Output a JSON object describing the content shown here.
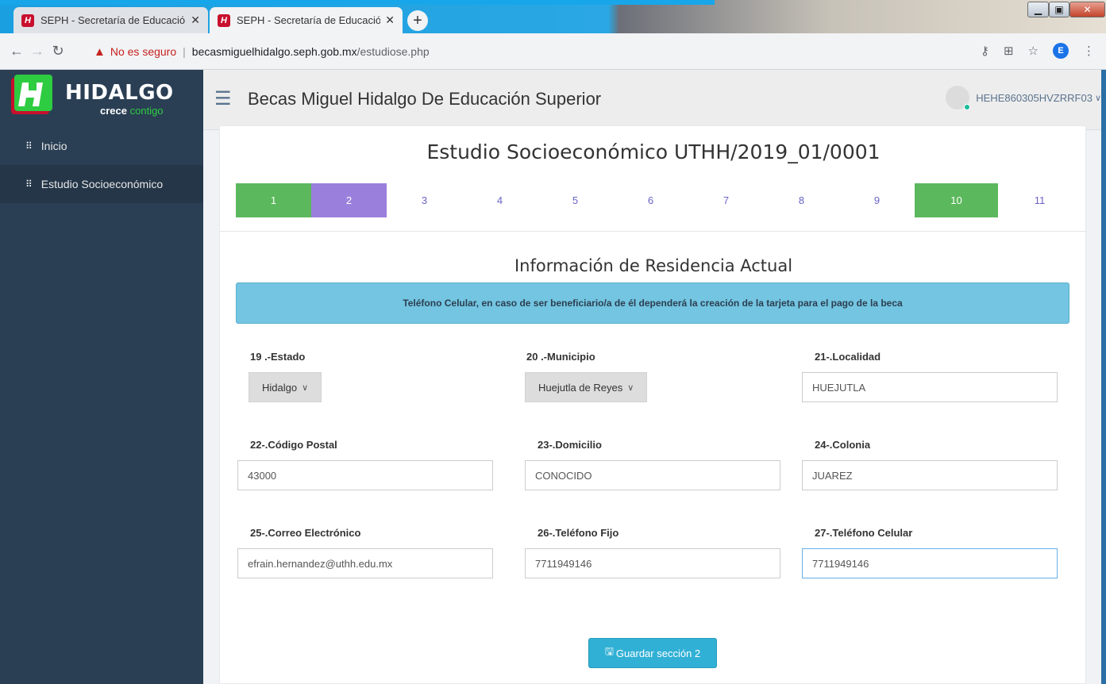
{
  "browser": {
    "tabs": [
      {
        "title": "SEPH - Secretaría de Educación P",
        "close": "✕",
        "active": false
      },
      {
        "title": "SEPH - Secretaría de Educación P",
        "close": "✕",
        "active": true
      }
    ],
    "new_tab": "+",
    "favicon_letter": "H",
    "security_label": "No es seguro",
    "url_host": "becasmiguelhidalgo.seph.gob.mx",
    "url_path": "/estudiose.php",
    "profile_initial": "E"
  },
  "sidebar": {
    "brand_name": "HIDALGO",
    "brand_tag_main": "crece",
    "brand_tag_accent": "contigo",
    "items": [
      {
        "label": "Inicio",
        "active": false
      },
      {
        "label": "Estudio Socioeconómico",
        "active": true
      }
    ]
  },
  "header": {
    "title": "Becas Miguel Hidalgo De Educación Superior",
    "user": "HEHE860305HVZRRF03"
  },
  "study": {
    "title": "Estudio Socioeconómico UTHH/2019_01/0001",
    "steps": [
      {
        "label": "1",
        "state": "done"
      },
      {
        "label": "2",
        "state": "current"
      },
      {
        "label": "3",
        "state": "pending"
      },
      {
        "label": "4",
        "state": "pending"
      },
      {
        "label": "5",
        "state": "pending"
      },
      {
        "label": "6",
        "state": "pending"
      },
      {
        "label": "7",
        "state": "pending"
      },
      {
        "label": "8",
        "state": "pending"
      },
      {
        "label": "9",
        "state": "pending"
      },
      {
        "label": "10",
        "state": "done"
      },
      {
        "label": "11",
        "state": "pending"
      }
    ],
    "section_title": "Información de Residencia Actual",
    "alert": "Teléfono Celular, en caso de ser beneficiario/a de él dependerá la creación de la tarjeta para el pago de la beca"
  },
  "form": {
    "estado": {
      "label": "19 .-Estado",
      "value": "Hidalgo"
    },
    "municipio": {
      "label": "20 .-Municipio",
      "value": "Huejutla de Reyes"
    },
    "localidad": {
      "label": "21-.Localidad",
      "value": "HUEJUTLA"
    },
    "cp": {
      "label": "22-.Código Postal",
      "value": "43000"
    },
    "domicilio": {
      "label": "23-.Domicilio",
      "value": "CONOCIDO"
    },
    "colonia": {
      "label": "24-.Colonia",
      "value": "JUAREZ"
    },
    "correo": {
      "label": "25-.Correo Electrónico",
      "value": "efrain.hernandez@uthh.edu.mx"
    },
    "tel_fijo": {
      "label": "26-.Teléfono Fijo",
      "value": "7711949146"
    },
    "tel_cel": {
      "label": "27-.Teléfono Celular",
      "value": "7711949146"
    },
    "save_label": "Guardar sección 2"
  },
  "colors": {
    "step_done": "#5cb85c",
    "step_current": "#9b7fdc",
    "alert_bg": "#73c5e1",
    "save_btn": "#31b0d5",
    "sidebar_bg": "#2a3f54"
  }
}
